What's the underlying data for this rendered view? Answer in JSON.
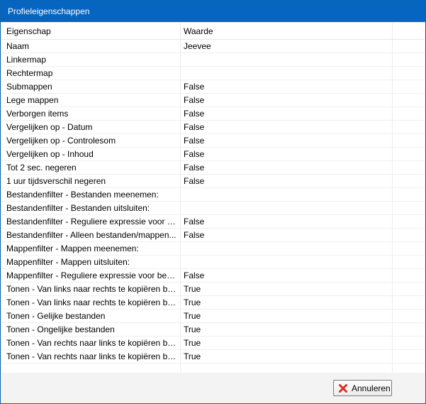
{
  "window": {
    "title": "Profieleigenschappen"
  },
  "table": {
    "columns": [
      "Eigenschap",
      "Waarde"
    ],
    "rows": [
      {
        "property": "Naam",
        "value": "Jeevee"
      },
      {
        "property": "Linkermap",
        "value": ""
      },
      {
        "property": "Rechtermap",
        "value": ""
      },
      {
        "property": "Submappen",
        "value": "False"
      },
      {
        "property": "Lege mappen",
        "value": "False"
      },
      {
        "property": "Verborgen items",
        "value": "False"
      },
      {
        "property": "Vergelijken op - Datum",
        "value": "False"
      },
      {
        "property": "Vergelijken op - Controlesom",
        "value": "False"
      },
      {
        "property": "Vergelijken op - Inhoud",
        "value": "False"
      },
      {
        "property": "Tot 2 sec. negeren",
        "value": "False"
      },
      {
        "property": "1 uur tijdsverschil negeren",
        "value": "False"
      },
      {
        "property": "Bestandenfilter - Bestanden meenemen:",
        "value": ""
      },
      {
        "property": "Bestandenfilter - Bestanden uitsluiten:",
        "value": ""
      },
      {
        "property": "Bestandenfilter - Reguliere expressie voor b...",
        "value": "False"
      },
      {
        "property": "Bestandenfilter - Alleen bestanden/mappen...",
        "value": "False"
      },
      {
        "property": "Mappenfilter - Mappen meenemen:",
        "value": ""
      },
      {
        "property": "Mappenfilter - Mappen uitsluiten:",
        "value": ""
      },
      {
        "property": "Mappenfilter - Reguliere expressie voor beid...",
        "value": "False"
      },
      {
        "property": "Tonen - Van links naar rechts te kopiëren be...",
        "value": "True"
      },
      {
        "property": "Tonen - Van links naar rechts te kopiëren be...",
        "value": "True"
      },
      {
        "property": "Tonen - Gelijke bestanden",
        "value": "True"
      },
      {
        "property": "Tonen - Ongelijke bestanden",
        "value": "True"
      },
      {
        "property": "Tonen - Van rechts naar links te kopiëren be...",
        "value": "True"
      },
      {
        "property": "Tonen - Van rechts naar links te kopiëren be...",
        "value": "True"
      }
    ]
  },
  "footer": {
    "cancel_label": "Annuleren",
    "cancel_icon": "red-x-icon"
  },
  "colors": {
    "titlebar": "#0565c0",
    "cancel_icon": "#d93025"
  }
}
